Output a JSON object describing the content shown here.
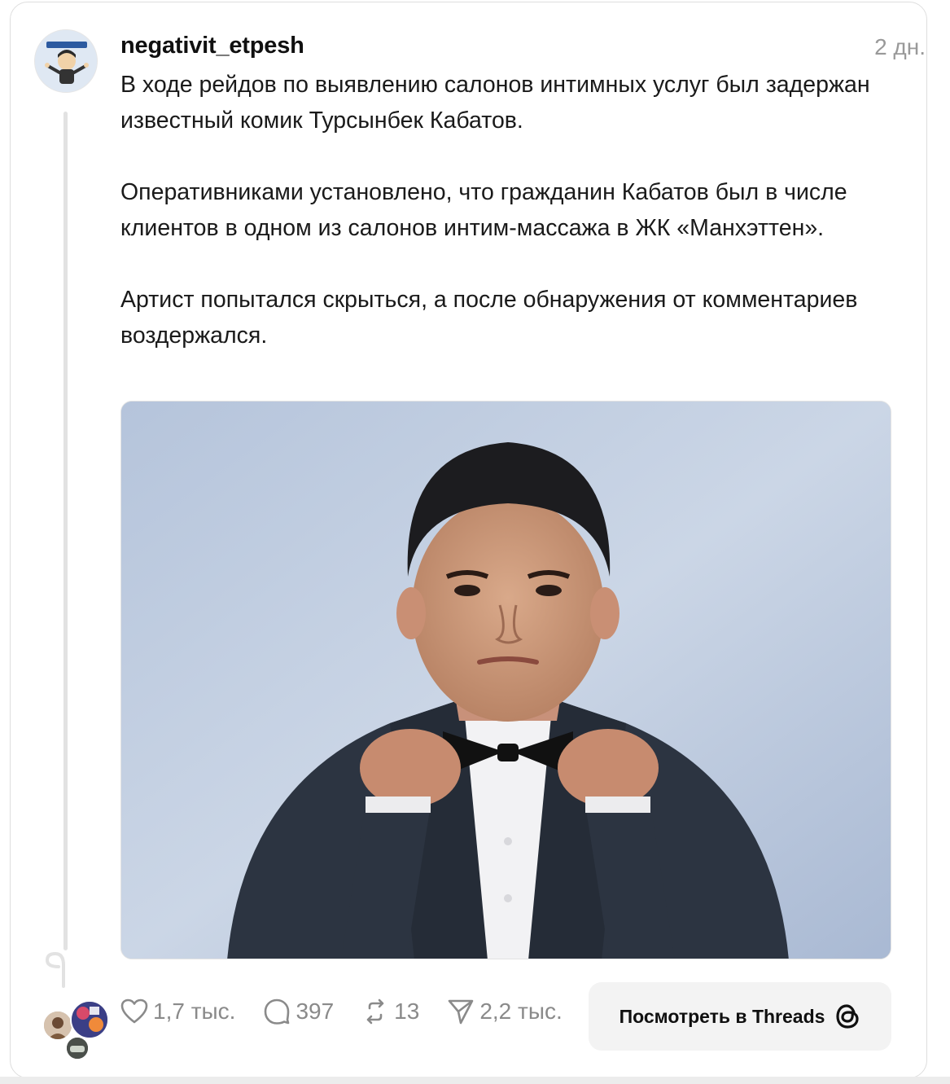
{
  "post": {
    "username": "negativit_etpesh",
    "time": "2 дн.",
    "paragraphs": [
      "В ходе рейдов по выявлению салонов интимных услуг был задержан известный комик Турсынбек Кабатов.",
      "Оперативниками установлено, что гражданин Кабатов был в числе клиентов в одном из салонов интим-массажа в ЖК «Манхэттен».",
      "Артист попытался скрыться, а после обнаружения от комментариев воздержался."
    ]
  },
  "actions": {
    "likes": "1,7 тыс.",
    "comments": "397",
    "reposts": "13",
    "shares": "2,2 тыс."
  },
  "view_button": {
    "label": "Посмотреть в Threads"
  },
  "icons": {
    "like": "heart-icon",
    "comment": "comment-bubble-icon",
    "repost": "repost-icon",
    "share": "send-icon",
    "threads": "threads-logo-icon"
  },
  "colors": {
    "muted": "#8a8a8a",
    "button_bg": "#f3f3f3",
    "thread_line": "#e2e2e2"
  }
}
